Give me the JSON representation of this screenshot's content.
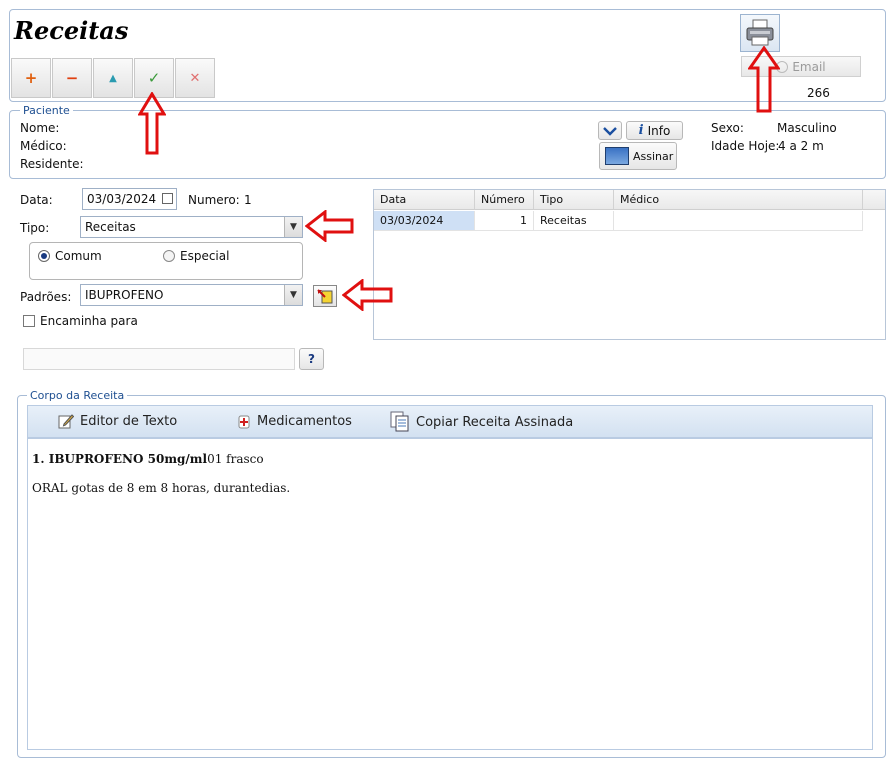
{
  "header": {
    "title": "Receitas",
    "email_label": "Email",
    "counter": "266"
  },
  "toolbar": {
    "add_symbol": "+",
    "remove_symbol": "−",
    "up_symbol": "▲",
    "confirm_symbol": "✓",
    "cancel_symbol": "✕"
  },
  "paciente": {
    "legend": "Paciente",
    "nome_label": "Nome:",
    "medico_label": "Médico:",
    "residente_label": "Residente:",
    "info_label": "Info",
    "assinar_label": "Assinar",
    "sexo_label": "Sexo:",
    "sexo_value": "Masculino",
    "idade_label": "Idade Hoje:",
    "idade_value": "4 a 2 m"
  },
  "form": {
    "data_label": "Data:",
    "data_value": "03/03/2024",
    "numero_label": "Numero:",
    "numero_value": "1",
    "tipo_label": "Tipo:",
    "tipo_value": "Receitas",
    "comum_label": "Comum",
    "especial_label": "Especial",
    "padroes_label": "Padrões:",
    "padroes_value": "IBUPROFENO",
    "encaminha_label": "Encaminha para",
    "question_label": "?"
  },
  "grid": {
    "columns": [
      "Data",
      "Número",
      "Tipo",
      "Médico"
    ],
    "rows": [
      {
        "data": "03/03/2024",
        "numero": "1",
        "tipo": "Receitas",
        "medico": ""
      }
    ]
  },
  "corpo": {
    "legend": "Corpo da Receita",
    "editor_label": "Editor de Texto",
    "medicamentos_label": "Medicamentos",
    "copiar_label": "Copiar Receita Assinada",
    "line1_bold": "1. IBUPROFENO 50mg/ml",
    "line1_rest": "01 frasco",
    "line2": "ORAL gotas de 8 em 8 horas, durantedias."
  },
  "colors": {
    "accent_blue": "#1e4f91",
    "panel_border": "#a8bcd6",
    "annotation_red": "#e01010",
    "selected_row": "#cfe0f5",
    "toolbar_band": "#dce8f5"
  }
}
